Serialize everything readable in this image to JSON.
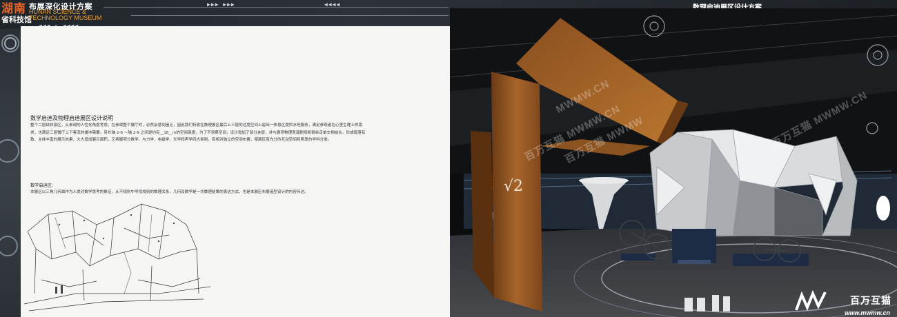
{
  "header": {
    "logo_top": "湖南",
    "logo_bottom": "省科技馆",
    "title_cn": "布展深化设计方案",
    "title_en": "HUNAN SCIENCE & TECHNOLOGY MUSEUM",
    "section_title": "数理启迪展区设计方案"
  },
  "description": {
    "heading": "数学启迪及物理启迪展区设计说明",
    "paragraph": "整个二层缺休息区，从参观的人性化角度考虑，在参观整个展厅时，必然会感到困乏，因此我们特意在数理展区最后上三层的过度空间上留出一休息区提供水吧服务，满足参观者在心里生理上的需求，也满足三层餐厅上下客流的缓冲需要。另外轴 2-6 ～轴 2-9 之间是约有__18__m的空间高度，为了不浪费空间，设计增加了部分夹层，并与展项物理表演剧场和钢丝走单车相结合，形成错落有致、主体丰富的展示效果，大大增加展示面积，又将展项分数学、与力学、电磁学、光学和声学四大类别，有相对独立的空间布置，使展区有充分的互动空间和明显的学科分类。",
    "math_heading": "数学启迪区:",
    "math_paragraph": "本展区以三角几何面作为人类对数学思考的象征，从不规则中寻找规则的数理关系，几何及数学是一切数理结果的表达方式，也是本展区布展造型设计的内容传达。"
  },
  "render": {
    "sqrt_label": "√2",
    "watermark_1": "MWMW.CN",
    "watermark_2": "百万互猫 MWMW.CN",
    "watermark_3": "百万互猫 MWMW",
    "watermark_4": "百万互猫 MWMW.CN",
    "bottom_logo_cn": "百万互猫",
    "bottom_logo_url": "www.mwmw.cn"
  },
  "colors": {
    "accent_orange": "#e8642a",
    "wood": "#9a5a24",
    "panel_bg": "#f5f5f4"
  }
}
